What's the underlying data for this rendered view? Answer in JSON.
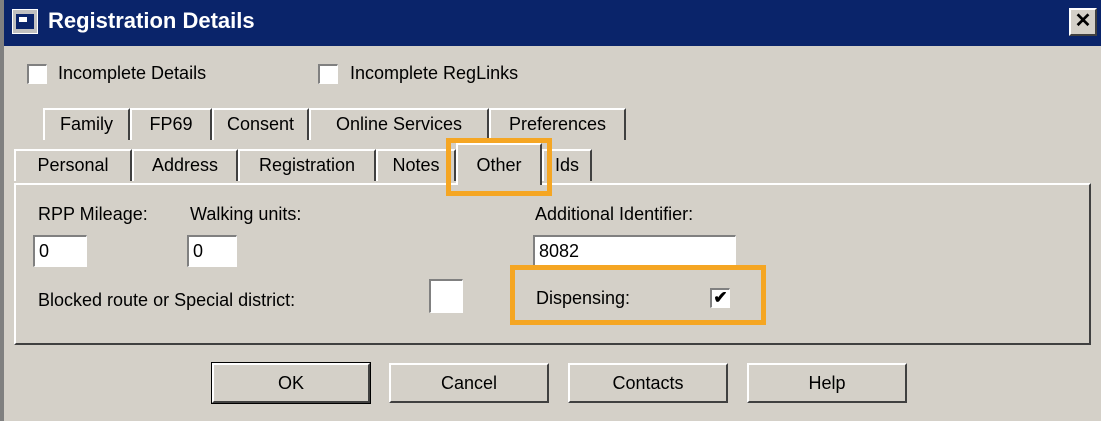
{
  "window": {
    "title": "Registration Details",
    "close_glyph": "✕"
  },
  "top_checks": [
    {
      "label": "Incomplete Details",
      "checked": false
    },
    {
      "label": "Incomplete RegLinks",
      "checked": false
    }
  ],
  "tabs_back_row": [
    "Family",
    "FP69",
    "Consent",
    "Online Services",
    "Preferences"
  ],
  "tabs_front_row": [
    "Personal",
    "Address",
    "Registration",
    "Notes",
    "Other",
    "Ids"
  ],
  "active_tab": "Other",
  "fields": {
    "rpp_mileage_label": "RPP Mileage:",
    "rpp_mileage_value": "0",
    "walking_units_label": "Walking units:",
    "walking_units_value": "0",
    "additional_identifier_label": "Additional Identifier:",
    "additional_identifier_value": "8082",
    "blocked_route_label": "Blocked route or Special district:",
    "blocked_route_checked": false,
    "dispensing_label": "Dispensing:",
    "dispensing_checked": true,
    "check_glyph": "✔"
  },
  "buttons": {
    "ok": "OK",
    "cancel": "Cancel",
    "contacts": "Contacts",
    "help": "Help"
  },
  "highlight_color": "#f5a623",
  "title_color": "#0a246a"
}
